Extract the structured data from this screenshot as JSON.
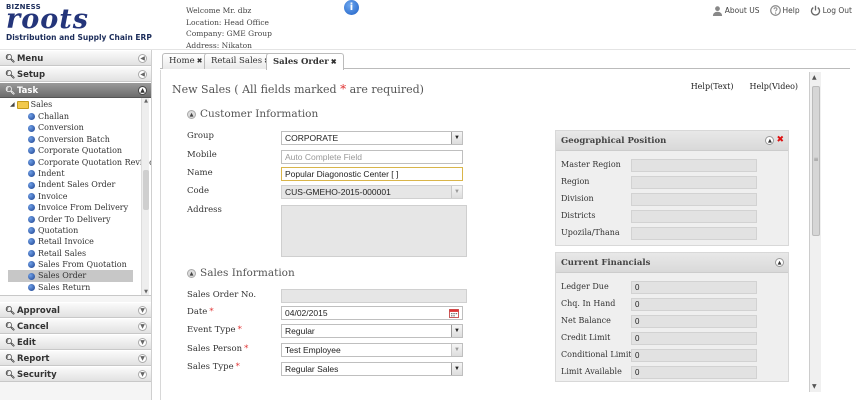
{
  "header": {
    "brand_top": "BIZNESS",
    "brand_name": "roots",
    "brand_tagline": "Distribution and Supply Chain ERP",
    "welcome": "Welcome Mr. dbz",
    "location": "Location: Head Office",
    "company": "Company: GME Group",
    "address": "Address: Nikaton",
    "info_glyph": "i",
    "links": {
      "about": "About US",
      "help": "Help",
      "logout": "Log Out"
    }
  },
  "sidebar": {
    "sections_top": [
      {
        "label": "Menu"
      },
      {
        "label": "Setup"
      },
      {
        "label": "Task"
      }
    ],
    "tree_folder": "Sales",
    "tree_items": [
      "Challan",
      "Conversion",
      "Conversion Batch",
      "Corporate Quotation",
      "Corporate Quotation Revision",
      "Indent",
      "Indent Sales Order",
      "Invoice",
      "Invoice From Delivery",
      "Order To Delivery",
      "Quotation",
      "Retail Invoice",
      "Retail Sales",
      "Sales From Quotation",
      "Sales Order",
      "Sales Return"
    ],
    "selected_item": "Sales Order",
    "sections_bottom": [
      {
        "label": "Approval"
      },
      {
        "label": "Cancel"
      },
      {
        "label": "Edit"
      },
      {
        "label": "Report"
      },
      {
        "label": "Security"
      }
    ]
  },
  "tabs": [
    {
      "label": "Home"
    },
    {
      "label": "Retail Sales"
    },
    {
      "label": "Sales Order"
    }
  ],
  "active_tab": "Sales Order",
  "page": {
    "title_prefix": "New Sales ( All fields marked ",
    "title_star": "*",
    "title_suffix": " are required)",
    "help_text": "Help(Text)",
    "help_video": "Help(Video)"
  },
  "customer_info": {
    "title": "Customer Information",
    "group_label": "Group",
    "group_value": "CORPORATE",
    "mobile_label": "Mobile",
    "mobile_placeholder": "Auto Complete Field",
    "name_label": "Name",
    "name_value": "Popular Diagonostic Center [ ]",
    "code_label": "Code",
    "code_value": "CUS-GMEHO-2015-000001",
    "address_label": "Address"
  },
  "sales_info": {
    "title": "Sales Information",
    "order_no_label": "Sales Order No.",
    "order_no_value": "",
    "date_label": "Date",
    "date_value": "04/02/2015",
    "event_type_label": "Event Type",
    "event_type_value": "Regular",
    "person_label": "Sales Person",
    "person_value": "Test Employee",
    "type_label": "Sales Type",
    "type_value": "Regular Sales"
  },
  "geo_panel": {
    "title": "Geographical Position",
    "rows": [
      {
        "label": "Master Region",
        "value": ""
      },
      {
        "label": "Region",
        "value": ""
      },
      {
        "label": "Division",
        "value": ""
      },
      {
        "label": "Districts",
        "value": ""
      },
      {
        "label": "Upozila/Thana",
        "value": ""
      }
    ]
  },
  "financial_panel": {
    "title": "Current Financials",
    "rows": [
      {
        "label": "Ledger Due",
        "value": "0"
      },
      {
        "label": "Chq. In Hand",
        "value": "0"
      },
      {
        "label": "Net Balance",
        "value": "0"
      },
      {
        "label": "Credit Limit",
        "value": "0"
      },
      {
        "label": "Conditional Limit",
        "value": "0"
      },
      {
        "label": "Limit Available",
        "value": "0"
      }
    ]
  },
  "colors": {
    "brand": "#24357a",
    "required": "#e03131",
    "active_accordion": "#7a7a7a",
    "close": "#dd1111"
  }
}
